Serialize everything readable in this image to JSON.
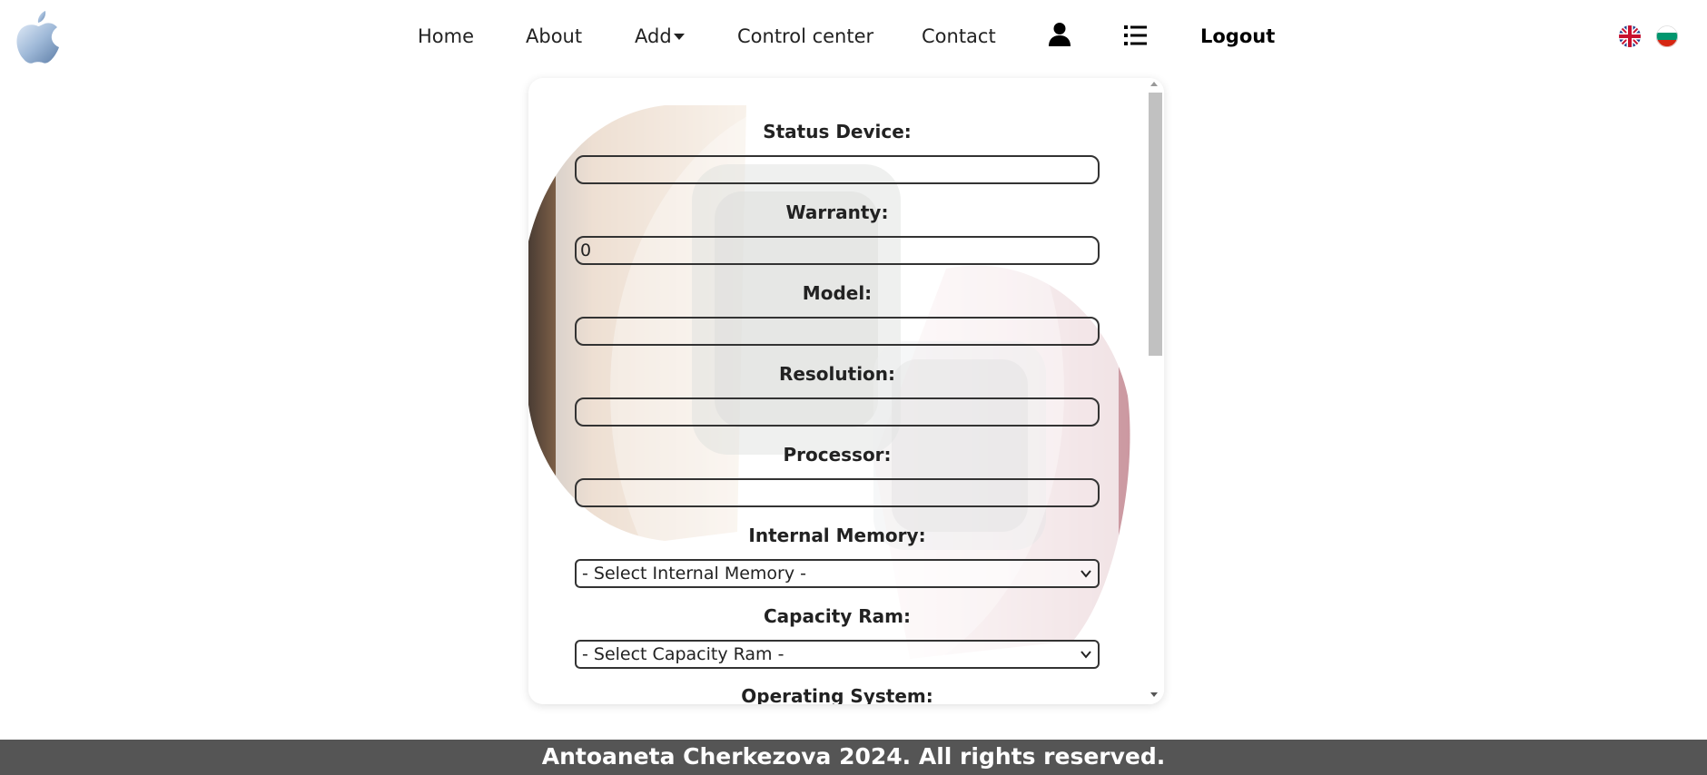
{
  "nav": {
    "home": "Home",
    "about": "About",
    "add": "Add",
    "control_center": "Control center",
    "contact": "Contact",
    "logout": "Logout"
  },
  "icons": {
    "logo": "apple-logo-icon",
    "profile": "user-icon",
    "list": "list-icon",
    "lang_en": "uk-flag-icon",
    "lang_bg": "bulgaria-flag-icon",
    "dropdown": "caret-down-icon"
  },
  "form": {
    "status_device": {
      "label": "Status Device:",
      "value": ""
    },
    "warranty": {
      "label": "Warranty:",
      "value": "0"
    },
    "model": {
      "label": "Model:",
      "value": ""
    },
    "resolution": {
      "label": "Resolution:",
      "value": ""
    },
    "processor": {
      "label": "Processor:",
      "value": ""
    },
    "internal_memory": {
      "label": "Internal Memory:",
      "selected": "- Select Internal Memory -"
    },
    "capacity_ram": {
      "label": "Capacity Ram:",
      "selected": "- Select Capacity Ram -"
    },
    "operating_system": {
      "label": "Operating System:"
    }
  },
  "footer": {
    "text": "Antoaneta Cherkezova 2024. All rights reserved."
  },
  "colors": {
    "footer_bg": "#555555",
    "text": "#222222",
    "scroll_thumb": "#c1c1c1"
  }
}
